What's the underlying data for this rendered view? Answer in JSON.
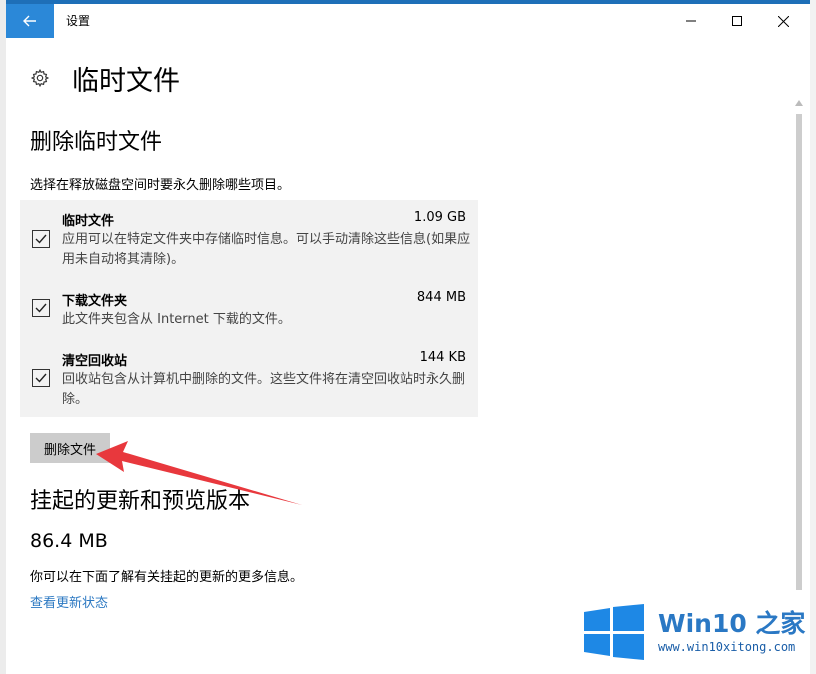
{
  "window": {
    "title": "设置"
  },
  "page": {
    "title": "临时文件"
  },
  "delete_section": {
    "title": "删除临时文件",
    "description": "选择在释放磁盘空间时要永久删除哪些项目。",
    "items": [
      {
        "name": "临时文件",
        "size": "1.09 GB",
        "checked": true,
        "description": "应用可以在特定文件夹中存储临时信息。可以手动清除这些信息(如果应用未自动将其清除)。"
      },
      {
        "name": "下载文件夹",
        "size": "844 MB",
        "checked": true,
        "description": "此文件夹包含从 Internet 下载的文件。"
      },
      {
        "name": "清空回收站",
        "size": "144 KB",
        "checked": true,
        "description": "回收站包含从计算机中删除的文件。这些文件将在清空回收站时永久删除。"
      }
    ],
    "delete_button": "删除文件"
  },
  "updates_section": {
    "title": "挂起的更新和预览版本",
    "size": "86.4 MB",
    "description": "你可以在下面了解有关挂起的更新的更多信息。",
    "link": "查看更新状态"
  },
  "watermark": {
    "brand": "Win10 之家",
    "url": "www.win10xitong.com"
  },
  "colors": {
    "accent": "#2b88d8",
    "link": "#2b78c2",
    "annotation": "#e8383d",
    "list_bg": "#f2f2f2"
  }
}
